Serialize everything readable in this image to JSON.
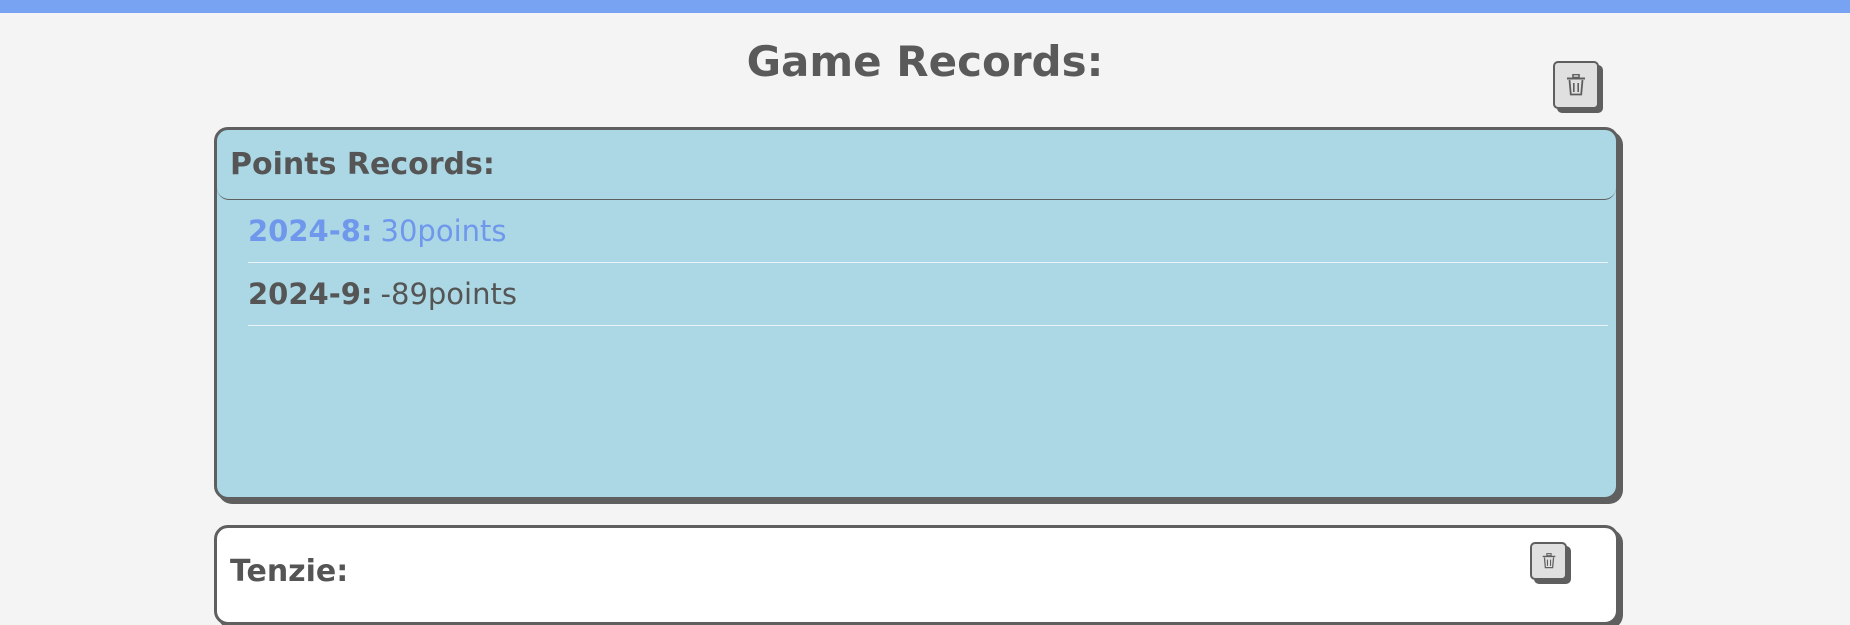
{
  "page": {
    "title": "Game Records:"
  },
  "points_panel": {
    "title": "Points Records:",
    "records": [
      {
        "date": "2024-8:",
        "value": "30points",
        "highlighted": true
      },
      {
        "date": "2024-9:",
        "value": "-89points",
        "highlighted": false
      }
    ]
  },
  "tenzie_panel": {
    "title": "Tenzie:"
  },
  "icons": {
    "delete_all": "trash-icon",
    "delete_tenzie": "trash-icon"
  },
  "colors": {
    "top_bar": "#77a3f2",
    "background": "#f4f4f4",
    "points_panel_bg": "#acd8e5",
    "tenzie_panel_bg": "#ffffff",
    "text": "#555555",
    "highlight_text": "#6f97ec"
  }
}
